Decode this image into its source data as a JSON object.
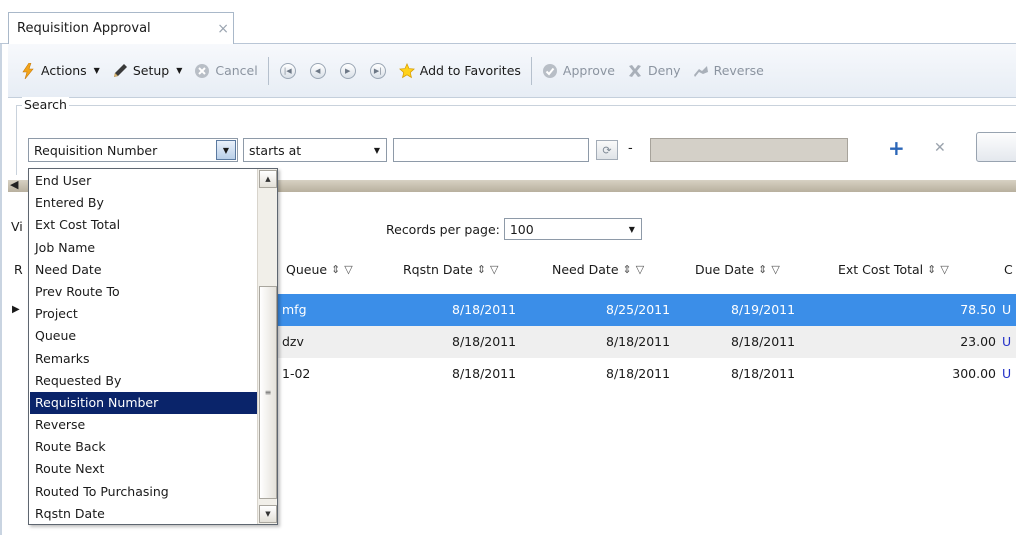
{
  "tab": {
    "title": "Requisition Approval",
    "close": "×"
  },
  "toolbar": {
    "actions_label": "Actions",
    "setup_label": "Setup",
    "cancel_label": "Cancel",
    "favorites_label": "Add to Favorites",
    "approve_label": "Approve",
    "deny_label": "Deny",
    "reverse_label": "Reverse"
  },
  "search": {
    "legend": "Search",
    "field_value": "Requisition Number",
    "operator_value": "starts at",
    "range_separator": "-"
  },
  "dropdown": {
    "items": [
      "End User",
      "Entered By",
      "Ext Cost Total",
      "Job Name",
      "Need Date",
      "Prev Route To",
      "Project",
      "Queue",
      "Remarks",
      "Requested By",
      "Requisition Number",
      "Reverse",
      "Route Back",
      "Route Next",
      "Routed To Purchasing",
      "Rqstn Date"
    ],
    "selected": "Requisition Number"
  },
  "grid": {
    "vi_label": "Vi",
    "r_label": "R",
    "records_label": "Records per page:",
    "records_value": "100",
    "columns": [
      "Queue",
      "Rqstn Date",
      "Need Date",
      "Due Date",
      "Ext Cost Total",
      "C"
    ],
    "rows": [
      {
        "queue": "mfg",
        "rqstn_date": "8/18/2011",
        "need_date": "8/25/2011",
        "due_date": "8/19/2011",
        "ext_cost": "78.50",
        "c": "U"
      },
      {
        "queue": "dzv",
        "rqstn_date": "8/18/2011",
        "need_date": "8/18/2011",
        "due_date": "8/18/2011",
        "ext_cost": "23.00",
        "c": "U"
      },
      {
        "queue": "1-02",
        "rqstn_date": "8/18/2011",
        "need_date": "8/18/2011",
        "due_date": "8/18/2011",
        "ext_cost": "300.00",
        "c": "U"
      }
    ]
  },
  "colors": {
    "selection": "#3b8ee8",
    "list_selection": "#0a246a",
    "link": "#2330c8"
  }
}
